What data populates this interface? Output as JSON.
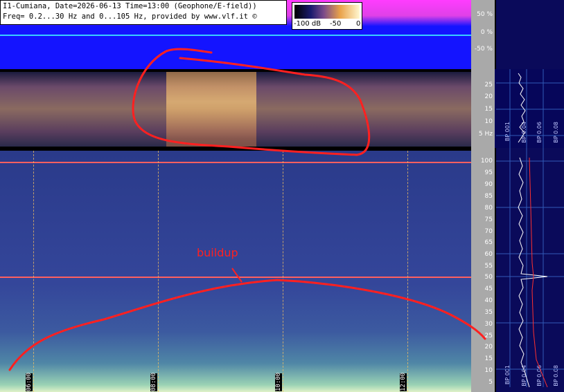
{
  "header": {
    "line1": "I1-Cumiana, Date=2026-06-13 Time=13:00 (Geophone/E-field))",
    "line2": "Freq= 0.2...30 Hz and 0...105 Hz, provided by www.vlf.it ©"
  },
  "color_scale": {
    "label_min": "-100 dB",
    "label_mid": "-50",
    "label_max": "0"
  },
  "waveform_axis": [
    "50 %",
    "0 %",
    "-50 %"
  ],
  "spectrogram_low_axis": [
    "25",
    "20",
    "15",
    "10",
    "5 Hz"
  ],
  "spectrogram_high_axis": [
    "100",
    "95",
    "90",
    "85",
    "80",
    "75",
    "70",
    "65",
    "60",
    "55",
    "50",
    "45",
    "40",
    "35",
    "30",
    "25",
    "20",
    "15",
    "10",
    "5"
  ],
  "time_labels": [
    "06:00",
    "08:00",
    "10:00",
    "12:00"
  ],
  "annotation": {
    "label": "buildup"
  },
  "side_panel": {
    "bp_labels_top": [
      "BP 001",
      "BP 0.04",
      "BP 0.06",
      "BP 0.08"
    ],
    "bp_labels_bottom": [
      "BP 001",
      "BP 0.04",
      "BP 0.06",
      "BP 0.08"
    ]
  },
  "colors": {
    "annotation": "#ff2020",
    "wave_bg": "#1414ff",
    "wave_top": "#ff3cff",
    "zero_line": "#40f0ff"
  }
}
